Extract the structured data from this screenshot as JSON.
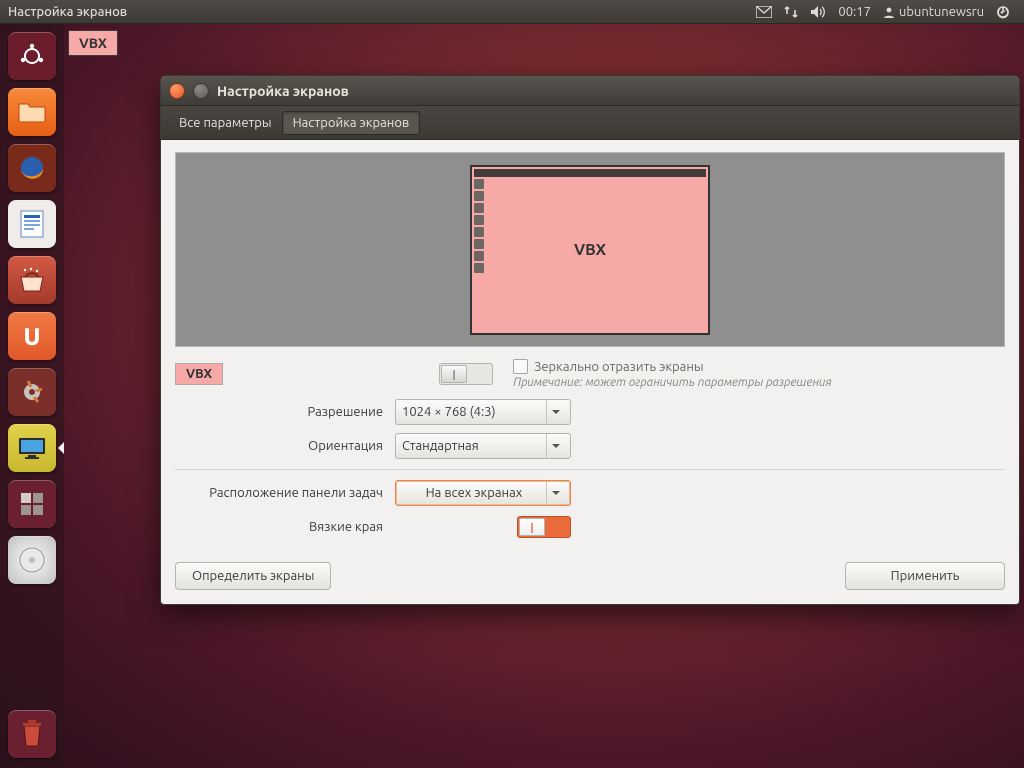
{
  "menubar": {
    "title": "Настройка экранов",
    "time": "00:17",
    "user": "ubuntunewsru"
  },
  "desktop": {
    "monitor_badge": "VBX"
  },
  "launcher": {
    "items": [
      {
        "name": "dash-icon",
        "color": "#6b1d2c"
      },
      {
        "name": "files-icon",
        "color": "#e65f14"
      },
      {
        "name": "firefox-icon",
        "color": "#7a2a1a"
      },
      {
        "name": "writer-icon",
        "color": "#1f6fb0"
      },
      {
        "name": "software-center-icon",
        "color": "#a43a2b"
      },
      {
        "name": "ubuntu-one-icon",
        "color": "#e1582b"
      },
      {
        "name": "settings-icon",
        "color": "#7a2f2a"
      },
      {
        "name": "displays-icon",
        "color": "#c9b92f",
        "active": true
      },
      {
        "name": "workspace-switcher-icon",
        "color": "#6a2030"
      },
      {
        "name": "disc-icon",
        "color": "#cfcfcf"
      }
    ],
    "trash": {
      "name": "trash-icon"
    }
  },
  "window": {
    "title": "Настройка экранов",
    "breadcrumbs": {
      "all": "Все параметры",
      "current": "Настройка экранов"
    },
    "preview": {
      "screen_label": "VBX"
    },
    "selected_display": "VBX",
    "display_enabled": false,
    "mirror": {
      "label": "Зеркально отразить экраны",
      "note": "Примечание: может ограничить параметры разрешения"
    },
    "resolution": {
      "label": "Разрешение",
      "value": "1024 × 768 (4:3)"
    },
    "orientation": {
      "label": "Ориентация",
      "value": "Стандартная"
    },
    "launcher_placement": {
      "label": "Расположение панели задач",
      "value": "На всех экранах"
    },
    "sticky_edges": {
      "label": "Вязкие края",
      "value": true
    },
    "buttons": {
      "detect": "Определить экраны",
      "apply": "Применить"
    }
  }
}
